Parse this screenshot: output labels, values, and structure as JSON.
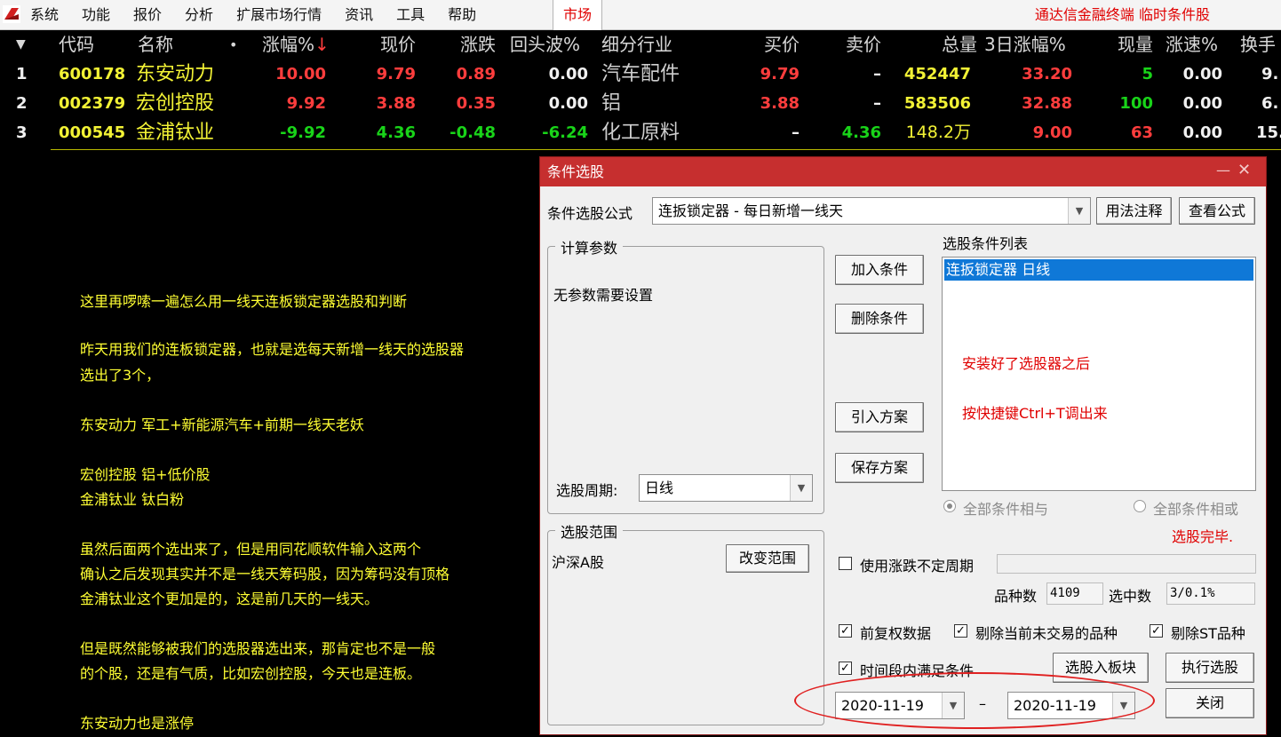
{
  "menubar": {
    "items": [
      "系统",
      "功能",
      "报价",
      "分析",
      "扩展市场行情",
      "资讯",
      "工具",
      "帮助"
    ],
    "market_tab": "市场",
    "terminal_title": "通达信金融终端 临时条件股"
  },
  "table": {
    "headers": [
      "代码",
      "名称",
      "•",
      "涨幅%↓",
      "现价",
      "涨跌",
      "回头波%",
      "细分行业",
      "买价",
      "卖价",
      "总量",
      "3日涨幅%",
      "现量",
      "涨速%",
      "换手"
    ],
    "rows": [
      {
        "idx": "1",
        "code": "600178",
        "name": "东安动力",
        "chg_pct": "10.00",
        "price": "9.79",
        "chg": "0.89",
        "pullback": "0.00",
        "industry": "汽车配件",
        "bid": "9.79",
        "ask": "–",
        "volume": "452447",
        "chg3d": "33.20",
        "cur_vol": "5",
        "speed": "0.00",
        "turnover": "9."
      },
      {
        "idx": "2",
        "code": "002379",
        "name": "宏创控股",
        "chg_pct": "9.92",
        "price": "3.88",
        "chg": "0.35",
        "pullback": "0.00",
        "industry": "铝",
        "bid": "3.88",
        "ask": "–",
        "volume": "583506",
        "chg3d": "32.88",
        "cur_vol": "100",
        "speed": "0.00",
        "turnover": "6."
      },
      {
        "idx": "3",
        "code": "000545",
        "name": "金浦钛业",
        "chg_pct": "-9.92",
        "price": "4.36",
        "chg": "-0.48",
        "pullback": "-6.24",
        "industry": "化工原料",
        "bid": "–",
        "ask": "4.36",
        "volume": "148.2万",
        "chg3d": "9.00",
        "cur_vol": "63",
        "speed": "0.00",
        "turnover": "15."
      }
    ]
  },
  "annotation": {
    "lines": [
      "这里再啰嗦一遍怎么用一线天连板锁定器选股和判断",
      "昨天用我们的连板锁定器，也就是选每天新增一线天的选股器",
      "选出了3个，",
      "东安动力  军工+新能源汽车+前期一线天老妖",
      "宏创控股  铝+低价股",
      "金浦钛业 钛白粉",
      "虽然后面两个选出来了，但是用同花顺软件输入这两个",
      "确认之后发现其实并不是一线天筹码股，因为筹码没有顶格",
      "金浦钛业这个更加是的，这是前几天的一线天。",
      "但是既然能够被我们的选股器选出来，那肯定也不是一般",
      "的个股，还是有气质，比如宏创控股，今天也是连板。",
      "东安动力也是涨停"
    ]
  },
  "dialog": {
    "title": "条件选股",
    "min_symbol": "—",
    "close_symbol": "✕",
    "formula_label": "条件选股公式",
    "formula_value": "连扳锁定器     - 每日新增一线天",
    "usage_button": "用法注释",
    "view_formula_button": "查看公式",
    "calc_params_label": "计算参数",
    "no_params_text": "无参数需要设置",
    "condition_list_label": "选股条件列表",
    "list_item": "连扳锁定器   日线",
    "list_note_1": "安装好了选股器之后",
    "list_note_2": "按快捷键Ctrl+T调出来",
    "add_condition_button": "加入条件",
    "delete_condition_button": "删除条件",
    "import_plan_button": "引入方案",
    "save_plan_button": "保存方案",
    "period_label": "选股周期:",
    "period_value": "日线",
    "radio_and": "全部条件相与",
    "radio_or": "全部条件相或",
    "status_text": "选股完毕.",
    "scope_label": "选股范围",
    "scope_value": "沪深A股",
    "change_scope_button": "改变范围",
    "use_variable_period": "使用涨跌不定周期",
    "stock_count_label": "品种数",
    "stock_count_value": "4109",
    "selected_count_label": "选中数",
    "selected_count_value": "3/0.1%",
    "pre_adjust_label": "前复权数据",
    "exclude_untraded_label": "剔除当前未交易的品种",
    "exclude_st_label": "剔除ST品种",
    "time_range_label": "时间段内满足条件",
    "to_block_button": "选股入板块",
    "execute_button": "执行选股",
    "close_button": "关闭",
    "date_from": "2020-11-19",
    "date_sep": "–",
    "date_to": "2020-11-19",
    "checkmark": "✓"
  },
  "colors": {
    "up": "#ff3d3d",
    "down": "#19d419",
    "code_yellow": "#f2f235",
    "annotation": "#ffff33",
    "title_bar": "#c62f2f",
    "selection": "#0f78d7"
  }
}
